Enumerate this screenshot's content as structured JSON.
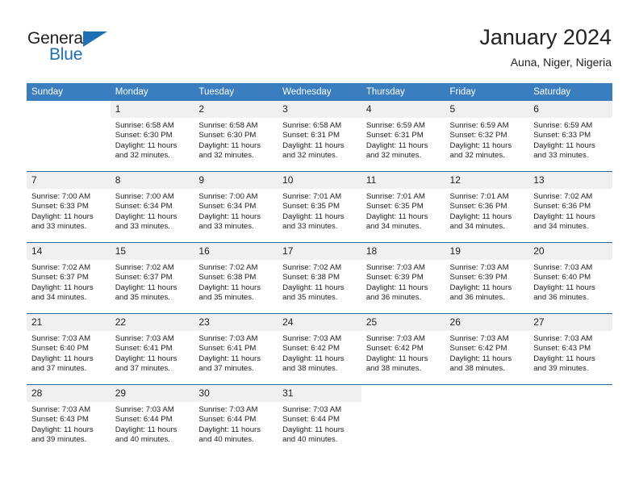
{
  "brand": {
    "name_top": "General",
    "name_bottom": "Blue",
    "accent_color": "#1f6fb5"
  },
  "header": {
    "title": "January 2024",
    "subtitle": "Auna, Niger, Nigeria"
  },
  "calendar": {
    "header_bg": "#3a7ebf",
    "daynum_bg": "#f0f0f0",
    "weekday_headers": [
      "Sunday",
      "Monday",
      "Tuesday",
      "Wednesday",
      "Thursday",
      "Friday",
      "Saturday"
    ],
    "weeks": [
      [
        {
          "day": "",
          "sunrise": "",
          "sunset": "",
          "daylight": "",
          "daylight2": ""
        },
        {
          "day": "1",
          "sunrise": "Sunrise: 6:58 AM",
          "sunset": "Sunset: 6:30 PM",
          "daylight": "Daylight: 11 hours",
          "daylight2": "and 32 minutes."
        },
        {
          "day": "2",
          "sunrise": "Sunrise: 6:58 AM",
          "sunset": "Sunset: 6:30 PM",
          "daylight": "Daylight: 11 hours",
          "daylight2": "and 32 minutes."
        },
        {
          "day": "3",
          "sunrise": "Sunrise: 6:58 AM",
          "sunset": "Sunset: 6:31 PM",
          "daylight": "Daylight: 11 hours",
          "daylight2": "and 32 minutes."
        },
        {
          "day": "4",
          "sunrise": "Sunrise: 6:59 AM",
          "sunset": "Sunset: 6:31 PM",
          "daylight": "Daylight: 11 hours",
          "daylight2": "and 32 minutes."
        },
        {
          "day": "5",
          "sunrise": "Sunrise: 6:59 AM",
          "sunset": "Sunset: 6:32 PM",
          "daylight": "Daylight: 11 hours",
          "daylight2": "and 32 minutes."
        },
        {
          "day": "6",
          "sunrise": "Sunrise: 6:59 AM",
          "sunset": "Sunset: 6:33 PM",
          "daylight": "Daylight: 11 hours",
          "daylight2": "and 33 minutes."
        }
      ],
      [
        {
          "day": "7",
          "sunrise": "Sunrise: 7:00 AM",
          "sunset": "Sunset: 6:33 PM",
          "daylight": "Daylight: 11 hours",
          "daylight2": "and 33 minutes."
        },
        {
          "day": "8",
          "sunrise": "Sunrise: 7:00 AM",
          "sunset": "Sunset: 6:34 PM",
          "daylight": "Daylight: 11 hours",
          "daylight2": "and 33 minutes."
        },
        {
          "day": "9",
          "sunrise": "Sunrise: 7:00 AM",
          "sunset": "Sunset: 6:34 PM",
          "daylight": "Daylight: 11 hours",
          "daylight2": "and 33 minutes."
        },
        {
          "day": "10",
          "sunrise": "Sunrise: 7:01 AM",
          "sunset": "Sunset: 6:35 PM",
          "daylight": "Daylight: 11 hours",
          "daylight2": "and 33 minutes."
        },
        {
          "day": "11",
          "sunrise": "Sunrise: 7:01 AM",
          "sunset": "Sunset: 6:35 PM",
          "daylight": "Daylight: 11 hours",
          "daylight2": "and 34 minutes."
        },
        {
          "day": "12",
          "sunrise": "Sunrise: 7:01 AM",
          "sunset": "Sunset: 6:36 PM",
          "daylight": "Daylight: 11 hours",
          "daylight2": "and 34 minutes."
        },
        {
          "day": "13",
          "sunrise": "Sunrise: 7:02 AM",
          "sunset": "Sunset: 6:36 PM",
          "daylight": "Daylight: 11 hours",
          "daylight2": "and 34 minutes."
        }
      ],
      [
        {
          "day": "14",
          "sunrise": "Sunrise: 7:02 AM",
          "sunset": "Sunset: 6:37 PM",
          "daylight": "Daylight: 11 hours",
          "daylight2": "and 34 minutes."
        },
        {
          "day": "15",
          "sunrise": "Sunrise: 7:02 AM",
          "sunset": "Sunset: 6:37 PM",
          "daylight": "Daylight: 11 hours",
          "daylight2": "and 35 minutes."
        },
        {
          "day": "16",
          "sunrise": "Sunrise: 7:02 AM",
          "sunset": "Sunset: 6:38 PM",
          "daylight": "Daylight: 11 hours",
          "daylight2": "and 35 minutes."
        },
        {
          "day": "17",
          "sunrise": "Sunrise: 7:02 AM",
          "sunset": "Sunset: 6:38 PM",
          "daylight": "Daylight: 11 hours",
          "daylight2": "and 35 minutes."
        },
        {
          "day": "18",
          "sunrise": "Sunrise: 7:03 AM",
          "sunset": "Sunset: 6:39 PM",
          "daylight": "Daylight: 11 hours",
          "daylight2": "and 36 minutes."
        },
        {
          "day": "19",
          "sunrise": "Sunrise: 7:03 AM",
          "sunset": "Sunset: 6:39 PM",
          "daylight": "Daylight: 11 hours",
          "daylight2": "and 36 minutes."
        },
        {
          "day": "20",
          "sunrise": "Sunrise: 7:03 AM",
          "sunset": "Sunset: 6:40 PM",
          "daylight": "Daylight: 11 hours",
          "daylight2": "and 36 minutes."
        }
      ],
      [
        {
          "day": "21",
          "sunrise": "Sunrise: 7:03 AM",
          "sunset": "Sunset: 6:40 PM",
          "daylight": "Daylight: 11 hours",
          "daylight2": "and 37 minutes."
        },
        {
          "day": "22",
          "sunrise": "Sunrise: 7:03 AM",
          "sunset": "Sunset: 6:41 PM",
          "daylight": "Daylight: 11 hours",
          "daylight2": "and 37 minutes."
        },
        {
          "day": "23",
          "sunrise": "Sunrise: 7:03 AM",
          "sunset": "Sunset: 6:41 PM",
          "daylight": "Daylight: 11 hours",
          "daylight2": "and 37 minutes."
        },
        {
          "day": "24",
          "sunrise": "Sunrise: 7:03 AM",
          "sunset": "Sunset: 6:42 PM",
          "daylight": "Daylight: 11 hours",
          "daylight2": "and 38 minutes."
        },
        {
          "day": "25",
          "sunrise": "Sunrise: 7:03 AM",
          "sunset": "Sunset: 6:42 PM",
          "daylight": "Daylight: 11 hours",
          "daylight2": "and 38 minutes."
        },
        {
          "day": "26",
          "sunrise": "Sunrise: 7:03 AM",
          "sunset": "Sunset: 6:42 PM",
          "daylight": "Daylight: 11 hours",
          "daylight2": "and 38 minutes."
        },
        {
          "day": "27",
          "sunrise": "Sunrise: 7:03 AM",
          "sunset": "Sunset: 6:43 PM",
          "daylight": "Daylight: 11 hours",
          "daylight2": "and 39 minutes."
        }
      ],
      [
        {
          "day": "28",
          "sunrise": "Sunrise: 7:03 AM",
          "sunset": "Sunset: 6:43 PM",
          "daylight": "Daylight: 11 hours",
          "daylight2": "and 39 minutes."
        },
        {
          "day": "29",
          "sunrise": "Sunrise: 7:03 AM",
          "sunset": "Sunset: 6:44 PM",
          "daylight": "Daylight: 11 hours",
          "daylight2": "and 40 minutes."
        },
        {
          "day": "30",
          "sunrise": "Sunrise: 7:03 AM",
          "sunset": "Sunset: 6:44 PM",
          "daylight": "Daylight: 11 hours",
          "daylight2": "and 40 minutes."
        },
        {
          "day": "31",
          "sunrise": "Sunrise: 7:03 AM",
          "sunset": "Sunset: 6:44 PM",
          "daylight": "Daylight: 11 hours",
          "daylight2": "and 40 minutes."
        },
        {
          "day": "",
          "sunrise": "",
          "sunset": "",
          "daylight": "",
          "daylight2": ""
        },
        {
          "day": "",
          "sunrise": "",
          "sunset": "",
          "daylight": "",
          "daylight2": ""
        },
        {
          "day": "",
          "sunrise": "",
          "sunset": "",
          "daylight": "",
          "daylight2": ""
        }
      ]
    ]
  }
}
